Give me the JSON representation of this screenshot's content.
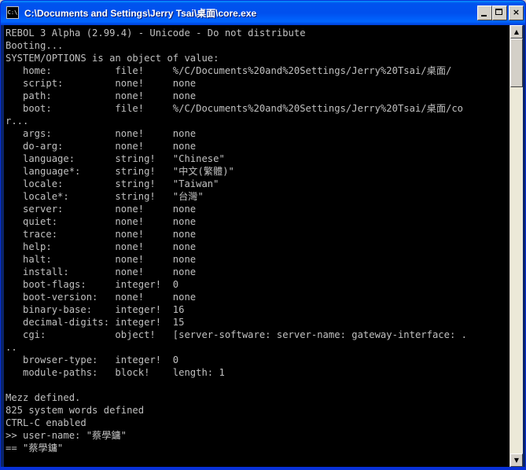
{
  "window": {
    "title": "C:\\Documents and Settings\\Jerry Tsai\\桌面\\core.exe",
    "icon_label": "C:\\",
    "icon": "console-icon",
    "buttons": {
      "minimize": "minimize-icon",
      "maximize": "maximize-icon",
      "close_label": "×"
    }
  },
  "console": {
    "lines": [
      "REBOL 3 Alpha (2.99.4) - Unicode - Do not distribute",
      "Booting...",
      "SYSTEM/OPTIONS is an object of value:",
      "   home:           file!     %/C/Documents%20and%20Settings/Jerry%20Tsai/桌面/",
      "   script:         none!     none",
      "   path:           none!     none",
      "   boot:           file!     %/C/Documents%20and%20Settings/Jerry%20Tsai/桌面/co",
      "r...",
      "   args:           none!     none",
      "   do-arg:         none!     none",
      "   language:       string!   \"Chinese\"",
      "   language*:      string!   \"中文(繁體)\"",
      "   locale:         string!   \"Taiwan\"",
      "   locale*:        string!   \"台灣\"",
      "   server:         none!     none",
      "   quiet:          none!     none",
      "   trace:          none!     none",
      "   help:           none!     none",
      "   halt:           none!     none",
      "   install:        none!     none",
      "   boot-flags:     integer!  0",
      "   boot-version:   none!     none",
      "   binary-base:    integer!  16",
      "   decimal-digits: integer!  15",
      "   cgi:            object!   [server-software: server-name: gateway-interface: .",
      "..",
      "   browser-type:   integer!  0",
      "   module-paths:   block!    length: 1",
      "",
      "Mezz defined.",
      "825 system words defined",
      "CTRL-C enabled",
      ">> user-name: \"蔡學鏞\"",
      "== \"蔡學鏞\""
    ]
  },
  "scrollbar": {
    "up_icon": "scroll-up-arrow-icon",
    "down_icon": "scroll-down-arrow-icon",
    "up_glyph": "▲",
    "down_glyph": "▼"
  },
  "colors": {
    "titlebar": "#0053ee",
    "console_bg": "#000000",
    "console_text": "#c0c0c0"
  }
}
